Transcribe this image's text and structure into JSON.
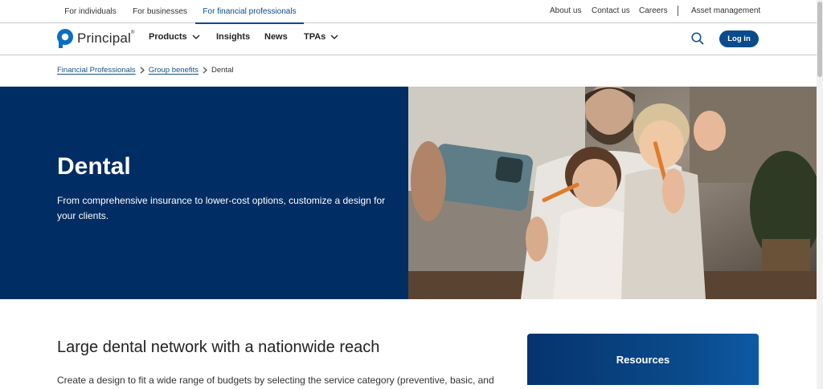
{
  "top_bar": {
    "audiences": [
      "For individuals",
      "For businesses",
      "For financial professionals"
    ],
    "active_audience": "For financial professionals",
    "utility_links": [
      "About us",
      "Contact us",
      "Careers",
      "Asset management"
    ]
  },
  "nav": {
    "logo_text": "Principal",
    "logo_mark": "®",
    "items": [
      {
        "label": "Products",
        "has_dropdown": true
      },
      {
        "label": "Insights",
        "has_dropdown": false
      },
      {
        "label": "News",
        "has_dropdown": false
      },
      {
        "label": "TPAs",
        "has_dropdown": true
      }
    ],
    "login_label": "Log in"
  },
  "breadcrumb": [
    "Financial Professionals",
    "Group benefits",
    "Dental"
  ],
  "hero": {
    "title": "Dental",
    "subtitle": "From comprehensive insurance to lower-cost options, customize a design for your clients."
  },
  "section": {
    "title": "Large dental network with a nationwide reach",
    "body": "Create a design to fit a wide range of budgets by selecting the service category (preventive, basic, and"
  },
  "resources": {
    "title": "Resources"
  },
  "colors": {
    "brand": "#0a4b8c",
    "hero_bg": "#002d63",
    "text": "#333333"
  }
}
